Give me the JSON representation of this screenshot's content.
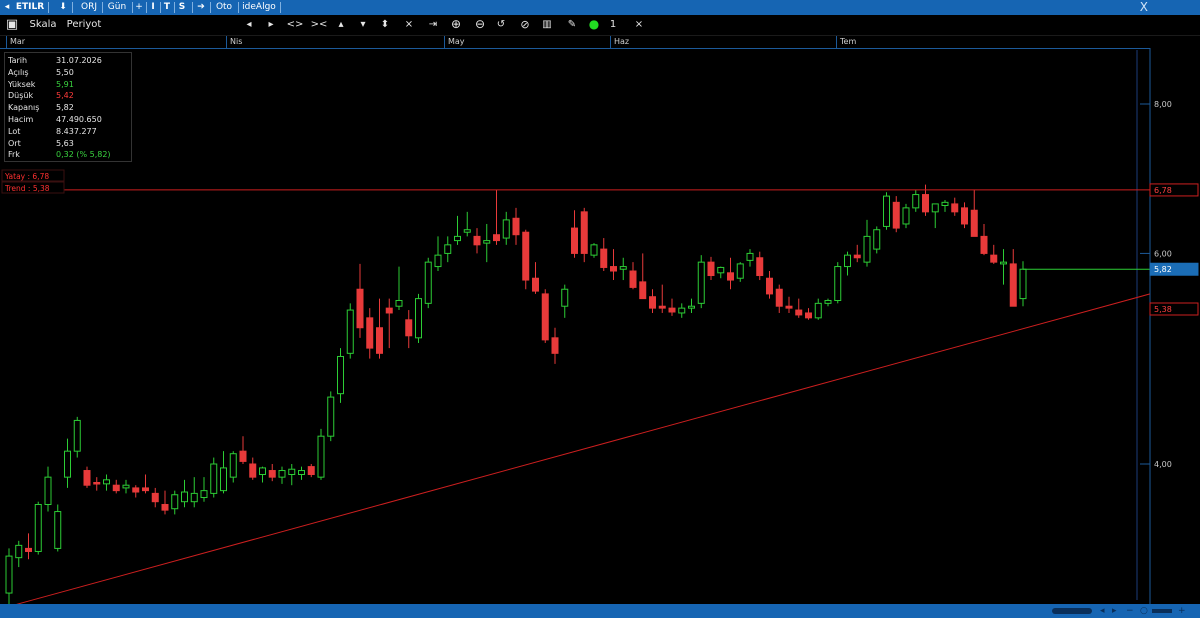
{
  "titlebar": {
    "symbol": "ETILR",
    "items": [
      "ORJ",
      "Gün",
      "I",
      "T",
      "S",
      "Oto",
      "ideAlgo"
    ],
    "close_symbol": "X"
  },
  "toolbar": {
    "scale_label": "Skala",
    "period_label": "Periyot",
    "count_label": "1",
    "close_symbol": "×"
  },
  "colors": {
    "up": "#2ccd35",
    "down": "#e83a3a",
    "trend": "#cc1f1f",
    "price_tag": "#1b6db6",
    "accent": "#1665b3"
  },
  "info": {
    "rows": [
      {
        "k": "Tarih",
        "v": "31.07.2026",
        "c": "#e6e6e6"
      },
      {
        "k": "Açılış",
        "v": "5,50",
        "c": "#e6e6e6"
      },
      {
        "k": "Yüksek",
        "v": "5,91",
        "c": "#39d23f"
      },
      {
        "k": "Düşük",
        "v": "5,42",
        "c": "#ff3b3b"
      },
      {
        "k": "Kapanış",
        "v": "5,82",
        "c": "#e6e6e6"
      },
      {
        "k": "Hacim",
        "v": "47.490.650",
        "c": "#e6e6e6"
      },
      {
        "k": "Lot",
        "v": "8.437.277",
        "c": "#e6e6e6"
      },
      {
        "k": "Ort",
        "v": "5,63",
        "c": "#e6e6e6"
      },
      {
        "k": "Frk",
        "v": "0,32 (% 5,82)",
        "c": "#39d23f"
      }
    ]
  },
  "lines": {
    "yatay_label": "Yatay : 6,78",
    "trend_label": "Trend : 5,38",
    "yatay_value": 6.78,
    "trend_value": 5.38
  },
  "chart_data": {
    "type": "candlestick",
    "title": "",
    "x_months": [
      "Mar",
      "Nis",
      "May",
      "Haz",
      "Tem"
    ],
    "y_ticks": [
      "8,00",
      "6,00",
      "4,00"
    ],
    "price_tags": [
      "6,78",
      "5,82",
      "5,38"
    ],
    "last_close": 5.82,
    "ohlc": [
      [
        3.12,
        3.4,
        3.05,
        3.35
      ],
      [
        3.34,
        3.45,
        3.28,
        3.42
      ],
      [
        3.4,
        3.5,
        3.33,
        3.38
      ],
      [
        3.38,
        3.72,
        3.36,
        3.7
      ],
      [
        3.7,
        3.98,
        3.65,
        3.9
      ],
      [
        3.4,
        3.7,
        3.38,
        3.65
      ],
      [
        3.9,
        4.2,
        3.82,
        4.1
      ],
      [
        4.1,
        4.38,
        4.05,
        4.35
      ],
      [
        3.95,
        3.98,
        3.82,
        3.84
      ],
      [
        3.86,
        3.9,
        3.8,
        3.85
      ],
      [
        3.85,
        3.92,
        3.8,
        3.88
      ],
      [
        3.84,
        3.88,
        3.78,
        3.8
      ],
      [
        3.82,
        3.88,
        3.78,
        3.84
      ],
      [
        3.82,
        3.84,
        3.75,
        3.79
      ],
      [
        3.82,
        3.92,
        3.78,
        3.8
      ],
      [
        3.78,
        3.82,
        3.68,
        3.72
      ],
      [
        3.7,
        3.8,
        3.63,
        3.66
      ],
      [
        3.67,
        3.8,
        3.63,
        3.77
      ],
      [
        3.72,
        3.88,
        3.68,
        3.79
      ],
      [
        3.72,
        3.9,
        3.68,
        3.78
      ],
      [
        3.75,
        3.9,
        3.72,
        3.8
      ],
      [
        3.78,
        4.05,
        3.75,
        4.0
      ],
      [
        3.8,
        4.1,
        3.78,
        3.97
      ],
      [
        3.9,
        4.1,
        3.86,
        4.08
      ],
      [
        4.1,
        4.22,
        4.0,
        4.02
      ],
      [
        4.0,
        4.05,
        3.88,
        3.9
      ],
      [
        3.92,
        3.98,
        3.86,
        3.97
      ],
      [
        3.95,
        4.0,
        3.87,
        3.9
      ],
      [
        3.9,
        3.98,
        3.85,
        3.95
      ],
      [
        3.92,
        4.0,
        3.84,
        3.96
      ],
      [
        3.92,
        3.98,
        3.88,
        3.95
      ],
      [
        3.98,
        4.0,
        3.9,
        3.92
      ],
      [
        3.9,
        4.28,
        3.88,
        4.22
      ],
      [
        4.22,
        4.6,
        4.18,
        4.55
      ],
      [
        4.58,
        5.0,
        4.5,
        4.92
      ],
      [
        4.95,
        5.45,
        4.9,
        5.38
      ],
      [
        5.6,
        5.88,
        5.1,
        5.2
      ],
      [
        5.3,
        5.4,
        4.9,
        5.0
      ],
      [
        5.2,
        5.5,
        4.9,
        4.95
      ],
      [
        5.4,
        5.5,
        5.0,
        5.35
      ],
      [
        5.42,
        5.85,
        5.38,
        5.48
      ],
      [
        5.28,
        5.38,
        5.0,
        5.12
      ],
      [
        5.1,
        5.55,
        5.05,
        5.5
      ],
      [
        5.45,
        5.95,
        5.4,
        5.9
      ],
      [
        5.85,
        6.2,
        5.8,
        5.98
      ],
      [
        6.0,
        6.2,
        5.9,
        6.1
      ],
      [
        6.15,
        6.45,
        6.1,
        6.2
      ],
      [
        6.25,
        6.5,
        6.2,
        6.28
      ],
      [
        6.2,
        6.3,
        6.0,
        6.1
      ],
      [
        6.12,
        6.35,
        5.9,
        6.15
      ],
      [
        6.22,
        6.78,
        6.1,
        6.15
      ],
      [
        6.18,
        6.5,
        6.1,
        6.4
      ],
      [
        6.42,
        6.55,
        6.1,
        6.22
      ],
      [
        6.25,
        6.28,
        5.6,
        5.7
      ],
      [
        5.72,
        5.9,
        5.55,
        5.58
      ],
      [
        5.55,
        5.6,
        5.05,
        5.08
      ],
      [
        5.1,
        5.2,
        4.85,
        4.95
      ],
      [
        5.42,
        5.65,
        5.3,
        5.6
      ],
      [
        6.3,
        6.52,
        5.95,
        6.0
      ],
      [
        6.5,
        6.55,
        5.9,
        6.0
      ],
      [
        5.98,
        6.12,
        5.95,
        6.1
      ],
      [
        6.05,
        6.18,
        5.8,
        5.84
      ],
      [
        5.85,
        6.05,
        5.7,
        5.8
      ],
      [
        5.82,
        5.95,
        5.7,
        5.85
      ],
      [
        5.8,
        5.9,
        5.6,
        5.62
      ],
      [
        5.68,
        6.0,
        5.5,
        5.5
      ],
      [
        5.52,
        5.6,
        5.35,
        5.4
      ],
      [
        5.42,
        5.65,
        5.35,
        5.4
      ],
      [
        5.4,
        5.5,
        5.32,
        5.36
      ],
      [
        5.35,
        5.45,
        5.3,
        5.4
      ],
      [
        5.4,
        5.5,
        5.35,
        5.42
      ],
      [
        5.45,
        5.98,
        5.4,
        5.9
      ],
      [
        5.9,
        5.96,
        5.7,
        5.75
      ],
      [
        5.78,
        5.85,
        5.72,
        5.84
      ],
      [
        5.78,
        5.95,
        5.6,
        5.7
      ],
      [
        5.72,
        5.9,
        5.68,
        5.88
      ],
      [
        5.92,
        6.05,
        5.85,
        6.0
      ],
      [
        5.95,
        6.02,
        5.7,
        5.75
      ],
      [
        5.72,
        5.8,
        5.5,
        5.55
      ],
      [
        5.6,
        5.65,
        5.35,
        5.42
      ],
      [
        5.42,
        5.52,
        5.35,
        5.4
      ],
      [
        5.38,
        5.5,
        5.3,
        5.33
      ],
      [
        5.35,
        5.4,
        5.28,
        5.3
      ],
      [
        5.3,
        5.5,
        5.28,
        5.45
      ],
      [
        5.45,
        5.5,
        5.42,
        5.48
      ],
      [
        5.48,
        5.9,
        5.45,
        5.85
      ],
      [
        5.85,
        6.02,
        5.75,
        5.98
      ],
      [
        5.98,
        6.1,
        5.9,
        5.95
      ],
      [
        5.9,
        6.4,
        5.85,
        6.2
      ],
      [
        6.05,
        6.32,
        6.0,
        6.28
      ],
      [
        6.32,
        6.75,
        6.28,
        6.7
      ],
      [
        6.62,
        6.7,
        6.25,
        6.3
      ],
      [
        6.35,
        6.6,
        6.3,
        6.55
      ],
      [
        6.55,
        6.78,
        6.5,
        6.72
      ],
      [
        6.72,
        6.85,
        6.45,
        6.5
      ],
      [
        6.5,
        6.6,
        6.3,
        6.6
      ],
      [
        6.58,
        6.65,
        6.5,
        6.62
      ],
      [
        6.6,
        6.68,
        6.45,
        6.5
      ],
      [
        6.55,
        6.62,
        6.3,
        6.35
      ],
      [
        6.52,
        6.78,
        6.2,
        6.2
      ],
      [
        6.2,
        6.35,
        5.98,
        6.0
      ],
      [
        5.98,
        6.1,
        5.88,
        5.9
      ],
      [
        5.88,
        6.05,
        5.65,
        5.9
      ],
      [
        5.88,
        6.05,
        5.7,
        5.42
      ],
      [
        5.5,
        5.91,
        5.42,
        5.82
      ]
    ]
  }
}
